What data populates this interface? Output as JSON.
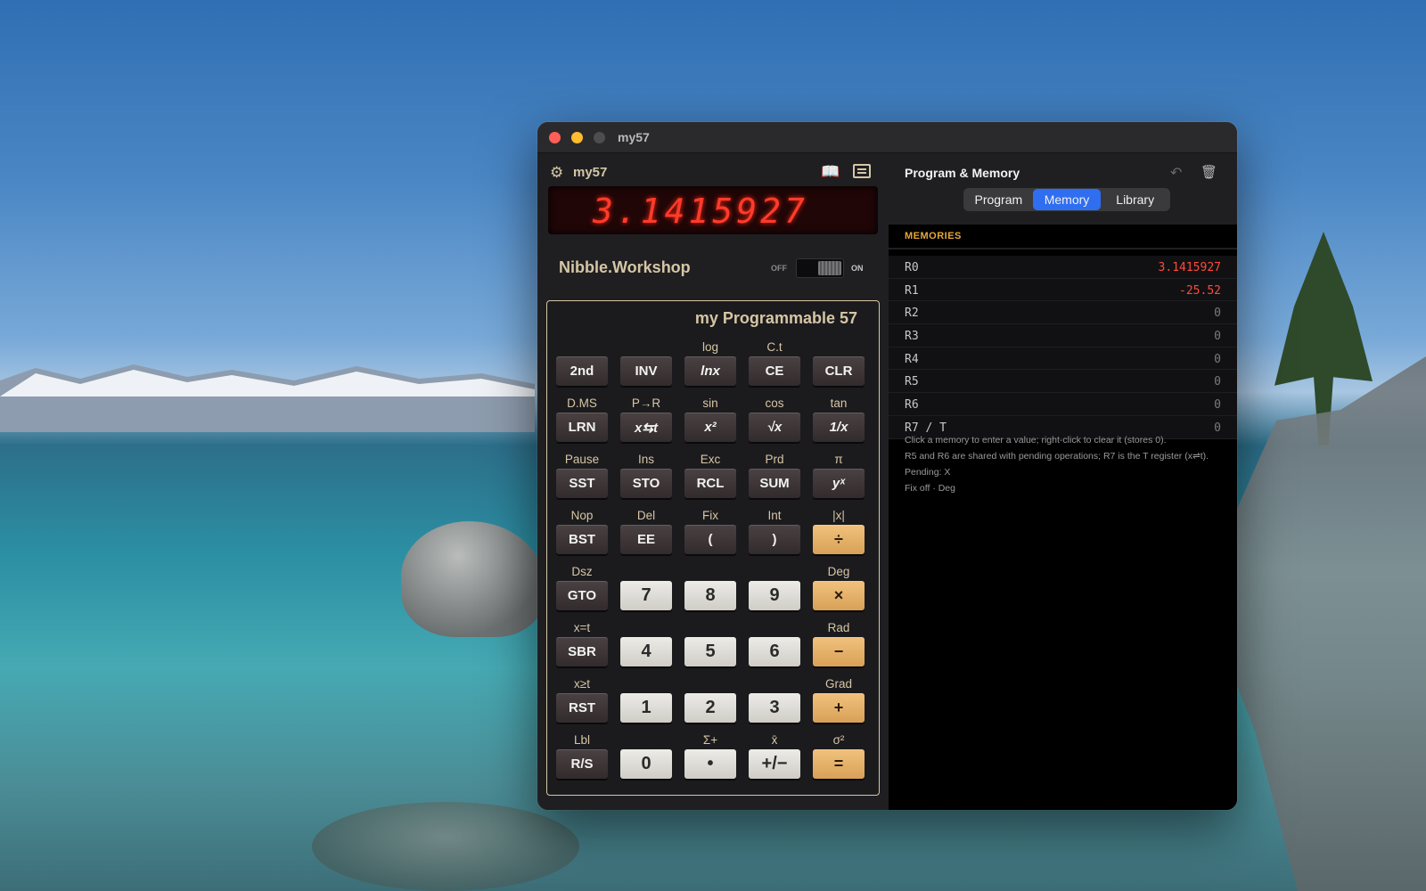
{
  "window": {
    "title": "my57"
  },
  "calc": {
    "app_name": "my57",
    "display_ghost": "8.8.8.8.8.8.8.8.8.8.8.",
    "display_value": "3.1415927",
    "brand": "Nibble.Workshop",
    "switch_off": "OFF",
    "switch_on": "ON",
    "keypad_title": "my Programmable 57",
    "keys": [
      [
        {
          "top": "",
          "label": "2nd",
          "style": "dark"
        },
        {
          "top": "",
          "label": "INV",
          "style": "dark"
        },
        {
          "top": "log",
          "label": "lnx",
          "style": "dark",
          "italic": true
        },
        {
          "top": "C.t",
          "label": "CE",
          "style": "dark"
        },
        {
          "top": "",
          "label": "CLR",
          "style": "dark"
        }
      ],
      [
        {
          "top": "D.MS",
          "label": "LRN",
          "style": "dark"
        },
        {
          "top": "P→R",
          "label": "x⇆t",
          "style": "dark",
          "italic": true
        },
        {
          "top": "sin",
          "label": "x²",
          "style": "dark",
          "italic": true
        },
        {
          "top": "cos",
          "label": "√x",
          "style": "dark",
          "italic": true
        },
        {
          "top": "tan",
          "label": "1/x",
          "style": "dark",
          "italic": true
        }
      ],
      [
        {
          "top": "Pause",
          "label": "SST",
          "style": "dark"
        },
        {
          "top": "Ins",
          "label": "STO",
          "style": "dark"
        },
        {
          "top": "Exc",
          "label": "RCL",
          "style": "dark"
        },
        {
          "top": "Prd",
          "label": "SUM",
          "style": "dark"
        },
        {
          "top": "π",
          "label": "yˣ",
          "style": "dark",
          "italic": true
        }
      ],
      [
        {
          "top": "Nop",
          "label": "BST",
          "style": "dark"
        },
        {
          "top": "Del",
          "label": "EE",
          "style": "dark"
        },
        {
          "top": "Fix",
          "label": "(",
          "style": "dark"
        },
        {
          "top": "Int",
          "label": ")",
          "style": "dark"
        },
        {
          "top": "|x|",
          "label": "÷",
          "style": "orange"
        }
      ],
      [
        {
          "top": "Dsz",
          "label": "GTO",
          "style": "dark"
        },
        {
          "top": "",
          "label": "7",
          "style": "light"
        },
        {
          "top": "",
          "label": "8",
          "style": "light"
        },
        {
          "top": "",
          "label": "9",
          "style": "light"
        },
        {
          "top": "Deg",
          "label": "×",
          "style": "orange"
        }
      ],
      [
        {
          "top": "x=t",
          "label": "SBR",
          "style": "dark"
        },
        {
          "top": "",
          "label": "4",
          "style": "light"
        },
        {
          "top": "",
          "label": "5",
          "style": "light"
        },
        {
          "top": "",
          "label": "6",
          "style": "light"
        },
        {
          "top": "Rad",
          "label": "−",
          "style": "orange"
        }
      ],
      [
        {
          "top": "x≥t",
          "label": "RST",
          "style": "dark"
        },
        {
          "top": "",
          "label": "1",
          "style": "light"
        },
        {
          "top": "",
          "label": "2",
          "style": "light"
        },
        {
          "top": "",
          "label": "3",
          "style": "light"
        },
        {
          "top": "Grad",
          "label": "+",
          "style": "orange"
        }
      ],
      [
        {
          "top": "Lbl",
          "label": "R/S",
          "style": "dark"
        },
        {
          "top": "",
          "label": "0",
          "style": "light"
        },
        {
          "top": "Σ+",
          "label": "•",
          "style": "light"
        },
        {
          "top": "x̄",
          "label": "+/−",
          "style": "light"
        },
        {
          "top": "σ²",
          "label": "=",
          "style": "orange"
        }
      ]
    ]
  },
  "panel": {
    "title": "Program & Memory",
    "tabs": [
      {
        "label": "Program",
        "active": false
      },
      {
        "label": "Memory",
        "active": true
      },
      {
        "label": "Library",
        "active": false
      }
    ],
    "section": "MEMORIES",
    "memories": [
      {
        "name": "R0",
        "value": "3.1415927",
        "highlight": true
      },
      {
        "name": "R1",
        "value": "-25.52",
        "highlight": true
      },
      {
        "name": "R2",
        "value": "0",
        "highlight": false
      },
      {
        "name": "R3",
        "value": "0",
        "highlight": false
      },
      {
        "name": "R4",
        "value": "0",
        "highlight": false
      },
      {
        "name": "R5",
        "value": "0",
        "highlight": false
      },
      {
        "name": "R6",
        "value": "0",
        "highlight": false
      },
      {
        "name": "R7 / T",
        "value": "0",
        "highlight": false
      }
    ],
    "notes": {
      "line1": "Click a memory to enter a value; right-click to clear it (stores 0).",
      "line2": "R5 and R6 are shared with pending operations; R7 is the T register (x⇌t).",
      "line3": "Pending: X",
      "line4": "Fix off · Deg"
    }
  },
  "icons": {
    "gear": "gear-icon",
    "book": "book-icon",
    "list": "list-icon",
    "undo": "undo-icon",
    "trash": "trash-icon"
  }
}
